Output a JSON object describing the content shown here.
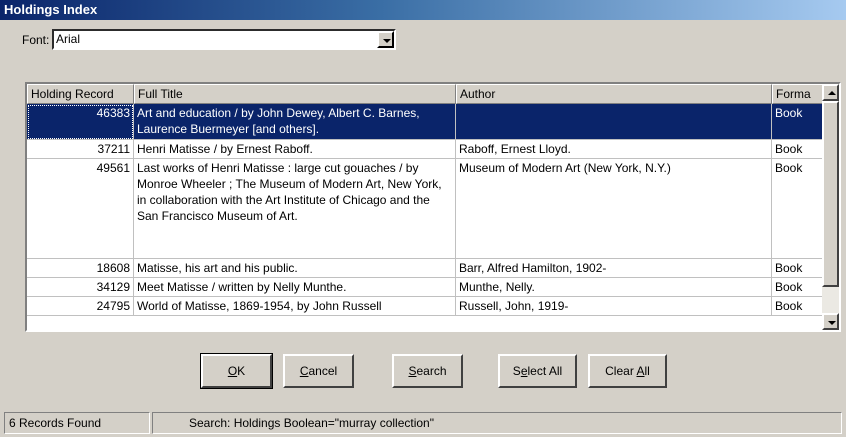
{
  "window": {
    "title": "Holdings Index"
  },
  "font": {
    "label": "Font:",
    "value": "Arial"
  },
  "table": {
    "columns": [
      "Holding Record",
      "Full Title",
      "Author",
      "Forma"
    ],
    "rows": [
      {
        "record": "46383",
        "title": "Art and education / by John Dewey, Albert C. Barnes, Laurence Buermeyer [and others].",
        "author": "",
        "format": "Book",
        "selected": true
      },
      {
        "record": "37211",
        "title": "Henri Matisse / by Ernest Raboff.",
        "author": "Raboff, Ernest Lloyd.",
        "format": "Book"
      },
      {
        "record": "49561",
        "title": "Last works of Henri Matisse : large cut gouaches / by Monroe Wheeler ; The Museum of Modern Art, New York, in collaboration with the Art Institute of Chicago and the San Francisco Museum of Art.",
        "author": "Museum of Modern Art (New York, N.Y.)",
        "format": "Book"
      },
      {
        "record": "18608",
        "title": "Matisse, his art and his public.",
        "author": "Barr, Alfred Hamilton, 1902-",
        "format": "Book"
      },
      {
        "record": "34129",
        "title": "Meet Matisse / written by Nelly Munthe.",
        "author": "Munthe, Nelly.",
        "format": "Book"
      },
      {
        "record": "24795",
        "title": "World of Matisse, 1869-1954, by John Russell",
        "author": "Russell, John, 1919-",
        "format": "Book"
      }
    ]
  },
  "buttons": {
    "ok": {
      "acc": "O",
      "rest": "K"
    },
    "cancel": {
      "acc": "C",
      "rest": "ancel"
    },
    "search": {
      "acc": "S",
      "rest": "earch"
    },
    "select_all": {
      "pre": "S",
      "acc": "e",
      "rest": "lect All"
    },
    "clear_all": {
      "pre": "Clear ",
      "acc": "A",
      "rest": "ll"
    }
  },
  "status": {
    "count": "6 Records Found",
    "query": "Search: Holdings Boolean=\"murray collection\""
  }
}
